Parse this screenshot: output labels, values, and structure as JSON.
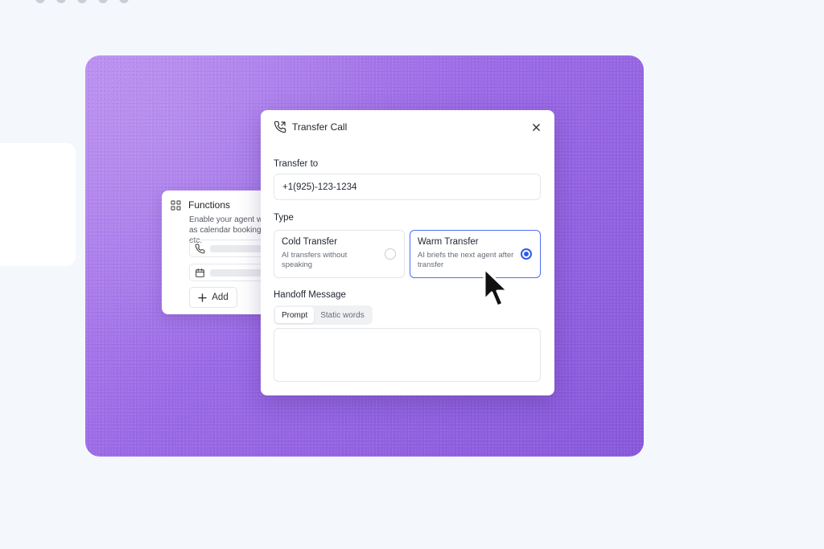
{
  "functions_card": {
    "title": "Functions",
    "description": "Enable your agent with capabilities such as calendar bookings, call termination, etc.",
    "add_label": "Add",
    "icons": [
      "grid-icon",
      "phone-icon",
      "calendar-icon",
      "plus-icon"
    ]
  },
  "dialog": {
    "title": "Transfer Call",
    "transfer_to_label": "Transfer to",
    "phone_value": "+1(925)-123-1234",
    "type_label": "Type",
    "options": [
      {
        "title": "Cold Transfer",
        "description": "AI transfers without speaking",
        "selected": false
      },
      {
        "title": "Warm Transfer",
        "description": "AI briefs the next agent after transfer",
        "selected": true
      }
    ],
    "handoff_label": "Handoff Message",
    "tabs": [
      "Prompt",
      "Static words"
    ],
    "active_tab": "Prompt",
    "message_value": ""
  },
  "colors": {
    "accent": "#2f5bea",
    "selected_border": "#4c6ef5",
    "background": "#f4f8fc",
    "purple": "#9a6ae6"
  }
}
